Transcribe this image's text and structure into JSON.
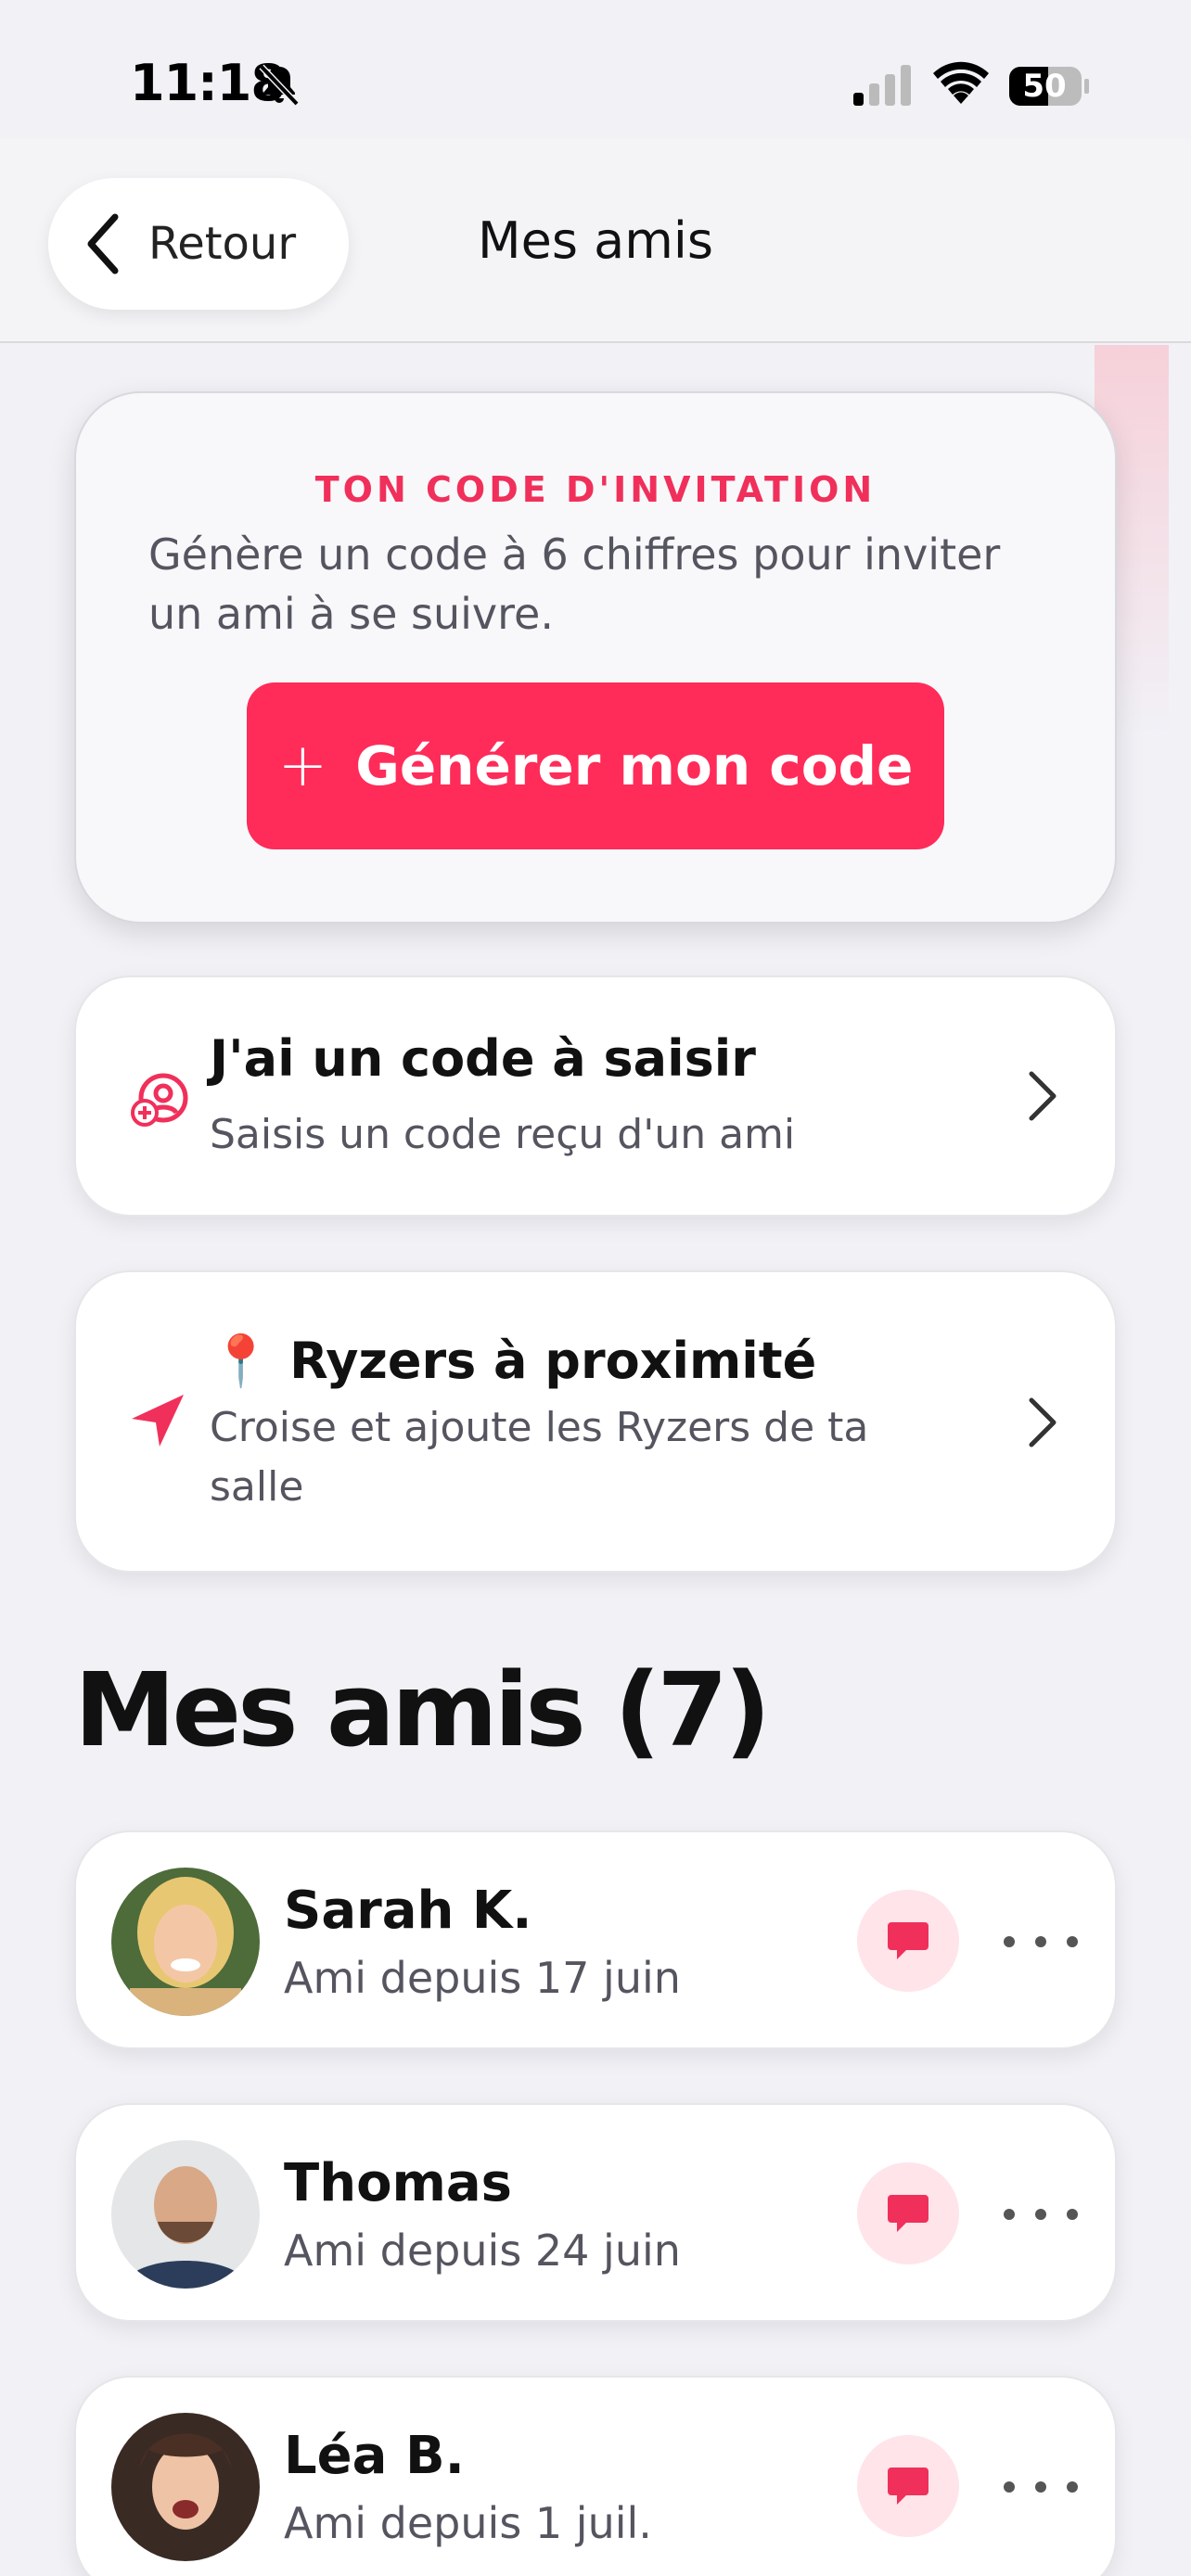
{
  "status_bar": {
    "time": "11:18",
    "battery": "50"
  },
  "header": {
    "back_label": "Retour",
    "title": "Mes amis"
  },
  "invite": {
    "kicker": "TON CODE D'INVITATION",
    "description": "Génère un code à 6 chiffres pour inviter un ami à se suivre.",
    "button_plus": "+",
    "button_label": "Générer mon code"
  },
  "actions": [
    {
      "icon": "user-add-icon",
      "title": "J'ai un code à saisir",
      "subtitle": "Saisis un code reçu d'un ami"
    },
    {
      "icon": "location-arrow-icon",
      "title_emoji": "📍",
      "title": "Ryzers à proximité",
      "subtitle": "Croise et ajoute les Ryzers de ta salle"
    }
  ],
  "friends_section": {
    "title": "Mes amis (7)"
  },
  "friends": [
    {
      "name": "Sarah K.",
      "since": "Ami depuis 17 juin"
    },
    {
      "name": "Thomas",
      "since": "Ami depuis 24 juin"
    },
    {
      "name": "Léa B.",
      "since": "Ami depuis 1 juil."
    }
  ],
  "colors": {
    "accent": "#ff2b59",
    "background": "#f1f1f6",
    "card": "#ffffff",
    "muted_text": "#555560"
  }
}
